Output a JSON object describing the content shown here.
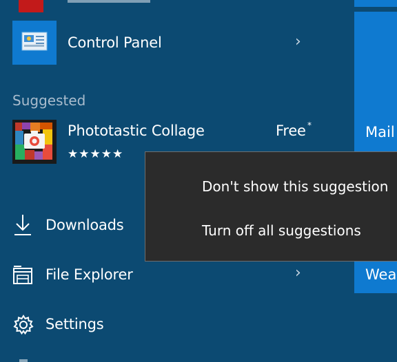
{
  "apps": {
    "control_panel": {
      "label": "Control Panel"
    }
  },
  "section": {
    "suggested_label": "Suggested"
  },
  "suggestion": {
    "name": "Phototastic Collage",
    "price": "Free",
    "price_mark": "*",
    "stars": "★★★★★"
  },
  "places": {
    "downloads": "Downloads",
    "file_explorer": "File Explorer",
    "settings": "Settings"
  },
  "tiles": {
    "mail": "Mail",
    "weather": "Wea"
  },
  "context_menu": {
    "items": [
      {
        "label": "Don't show this suggestion"
      },
      {
        "label": "Turn off all suggestions"
      }
    ]
  },
  "colors": {
    "background": "#0c4a72",
    "tile_blue": "#0f7ad0",
    "menu_bg": "#2b2b2b",
    "partial_app_icon": "#c21a1a"
  }
}
